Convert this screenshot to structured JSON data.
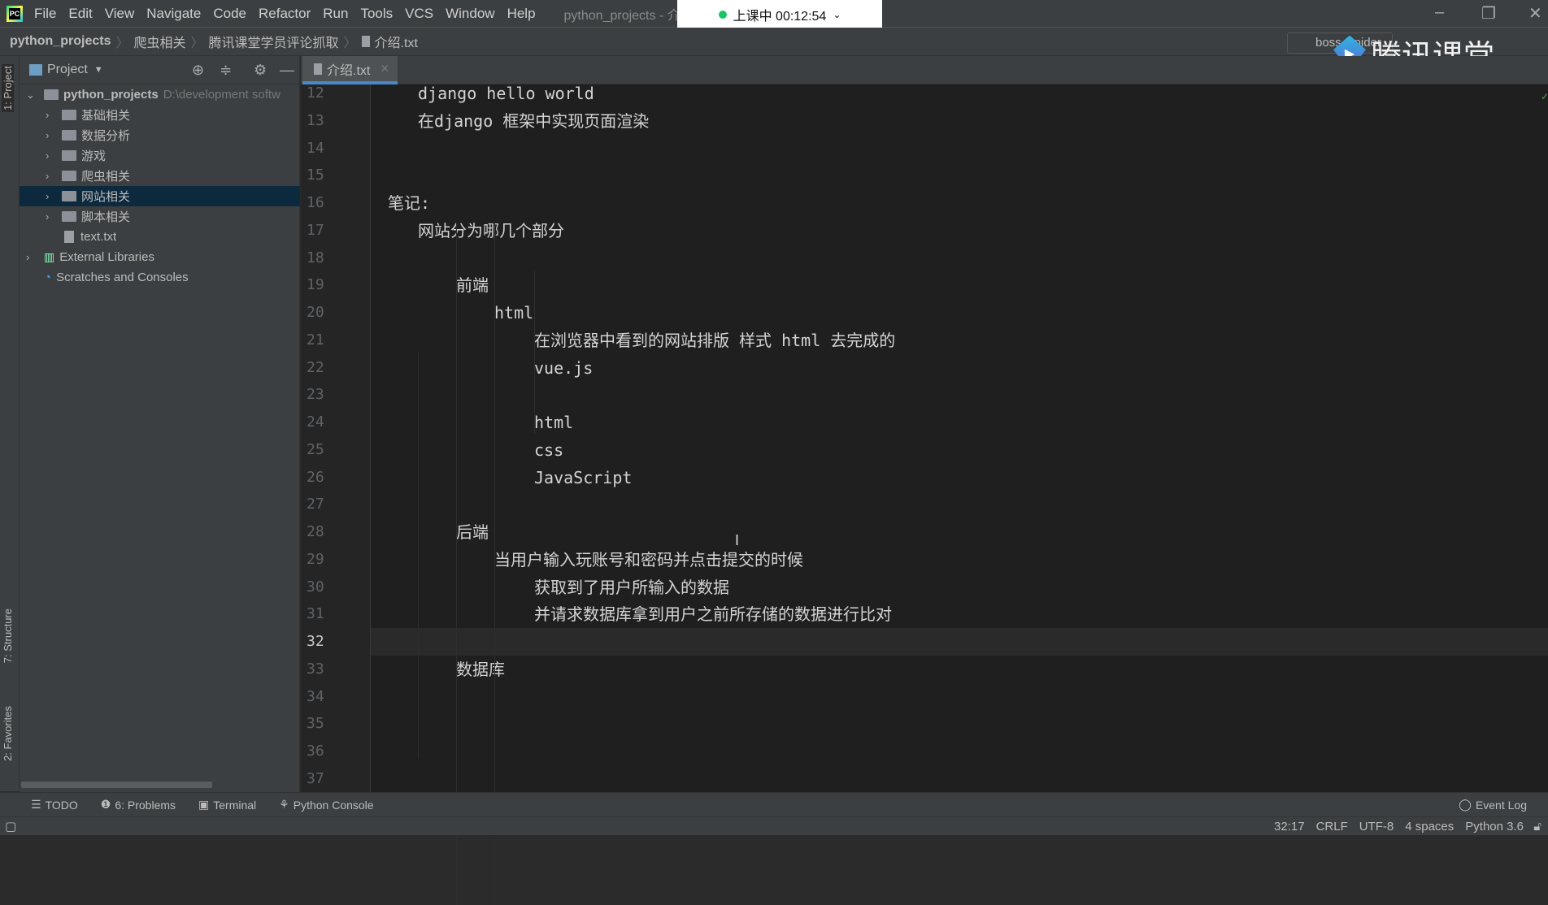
{
  "menubar": {
    "logo": "PC",
    "items": [
      "File",
      "Edit",
      "View",
      "Navigate",
      "Code",
      "Refactor",
      "Run",
      "Tools",
      "VCS",
      "Window",
      "Help"
    ],
    "window_title": "python_projects - 介"
  },
  "timer": {
    "label": "上课中 00:12:54",
    "status_color": "#1bc565"
  },
  "breadcrumb": [
    "python_projects",
    "爬虫相关",
    "腾讯课堂学员评论抓取",
    "介绍.txt"
  ],
  "run_config": "boss_spider",
  "brand": {
    "text": "腾讯课堂"
  },
  "left_strip": {
    "top": "1: Project",
    "structure": "7: Structure",
    "favorites": "2: Favorites"
  },
  "project": {
    "title": "Project",
    "root": {
      "name": "python_projects",
      "path": "D:\\development softw"
    },
    "children": [
      {
        "name": "基础相关",
        "type": "folder"
      },
      {
        "name": "数据分析",
        "type": "folder"
      },
      {
        "name": "游戏",
        "type": "folder"
      },
      {
        "name": "爬虫相关",
        "type": "folder"
      },
      {
        "name": "网站相关",
        "type": "folder",
        "selected": true
      },
      {
        "name": "脚本相关",
        "type": "folder"
      },
      {
        "name": "text.txt",
        "type": "file"
      }
    ],
    "external": "External Libraries",
    "scratches": "Scratches and Consoles"
  },
  "tab": {
    "label": "介绍.txt"
  },
  "editor": {
    "current_line": 32,
    "lines": [
      {
        "n": "12",
        "text": "django hello world",
        "indent": 1
      },
      {
        "n": "13",
        "text": "在django 框架中实现页面渲染",
        "indent": 1
      },
      {
        "n": "14",
        "text": "",
        "indent": 0
      },
      {
        "n": "15",
        "text": "",
        "indent": 0
      },
      {
        "n": "16",
        "text": "笔记:",
        "indent": 0
      },
      {
        "n": "17",
        "text": "网站分为哪几个部分",
        "indent": 1
      },
      {
        "n": "18",
        "text": "",
        "indent": 0
      },
      {
        "n": "19",
        "text": "前端",
        "indent": 2
      },
      {
        "n": "20",
        "text": "html",
        "indent": 3
      },
      {
        "n": "21",
        "text": "在浏览器中看到的网站排版 样式 html 去完成的",
        "indent": 4
      },
      {
        "n": "22",
        "text": "vue.js",
        "indent": 4
      },
      {
        "n": "23",
        "text": "",
        "indent": 0
      },
      {
        "n": "24",
        "text": "html",
        "indent": 4
      },
      {
        "n": "25",
        "text": "css",
        "indent": 4
      },
      {
        "n": "26",
        "text": "JavaScript",
        "indent": 4
      },
      {
        "n": "27",
        "text": "",
        "indent": 0
      },
      {
        "n": "28",
        "text": "后端",
        "indent": 2
      },
      {
        "n": "29",
        "text": "当用户输入玩账号和密码并点击提交的时候",
        "indent": 3
      },
      {
        "n": "30",
        "text": "获取到了用户所输入的数据",
        "indent": 4
      },
      {
        "n": "31",
        "text": "并请求数据库拿到用户之前所存储的数据进行比对",
        "indent": 4
      },
      {
        "n": "32",
        "text": "",
        "indent": 0
      },
      {
        "n": "33",
        "text": "数据库",
        "indent": 2
      },
      {
        "n": "34",
        "text": "",
        "indent": 0
      },
      {
        "n": "35",
        "text": "",
        "indent": 0
      },
      {
        "n": "36",
        "text": "",
        "indent": 0
      },
      {
        "n": "37",
        "text": "",
        "indent": 0
      }
    ]
  },
  "toolwindows": {
    "todo": "TODO",
    "problems": "6: Problems",
    "terminal": "Terminal",
    "python_console": "Python Console",
    "event_log": "Event Log"
  },
  "status": {
    "position": "32:17",
    "line_sep": "CRLF",
    "encoding": "UTF-8",
    "indent": "4 spaces",
    "interpreter": "Python 3.6"
  }
}
